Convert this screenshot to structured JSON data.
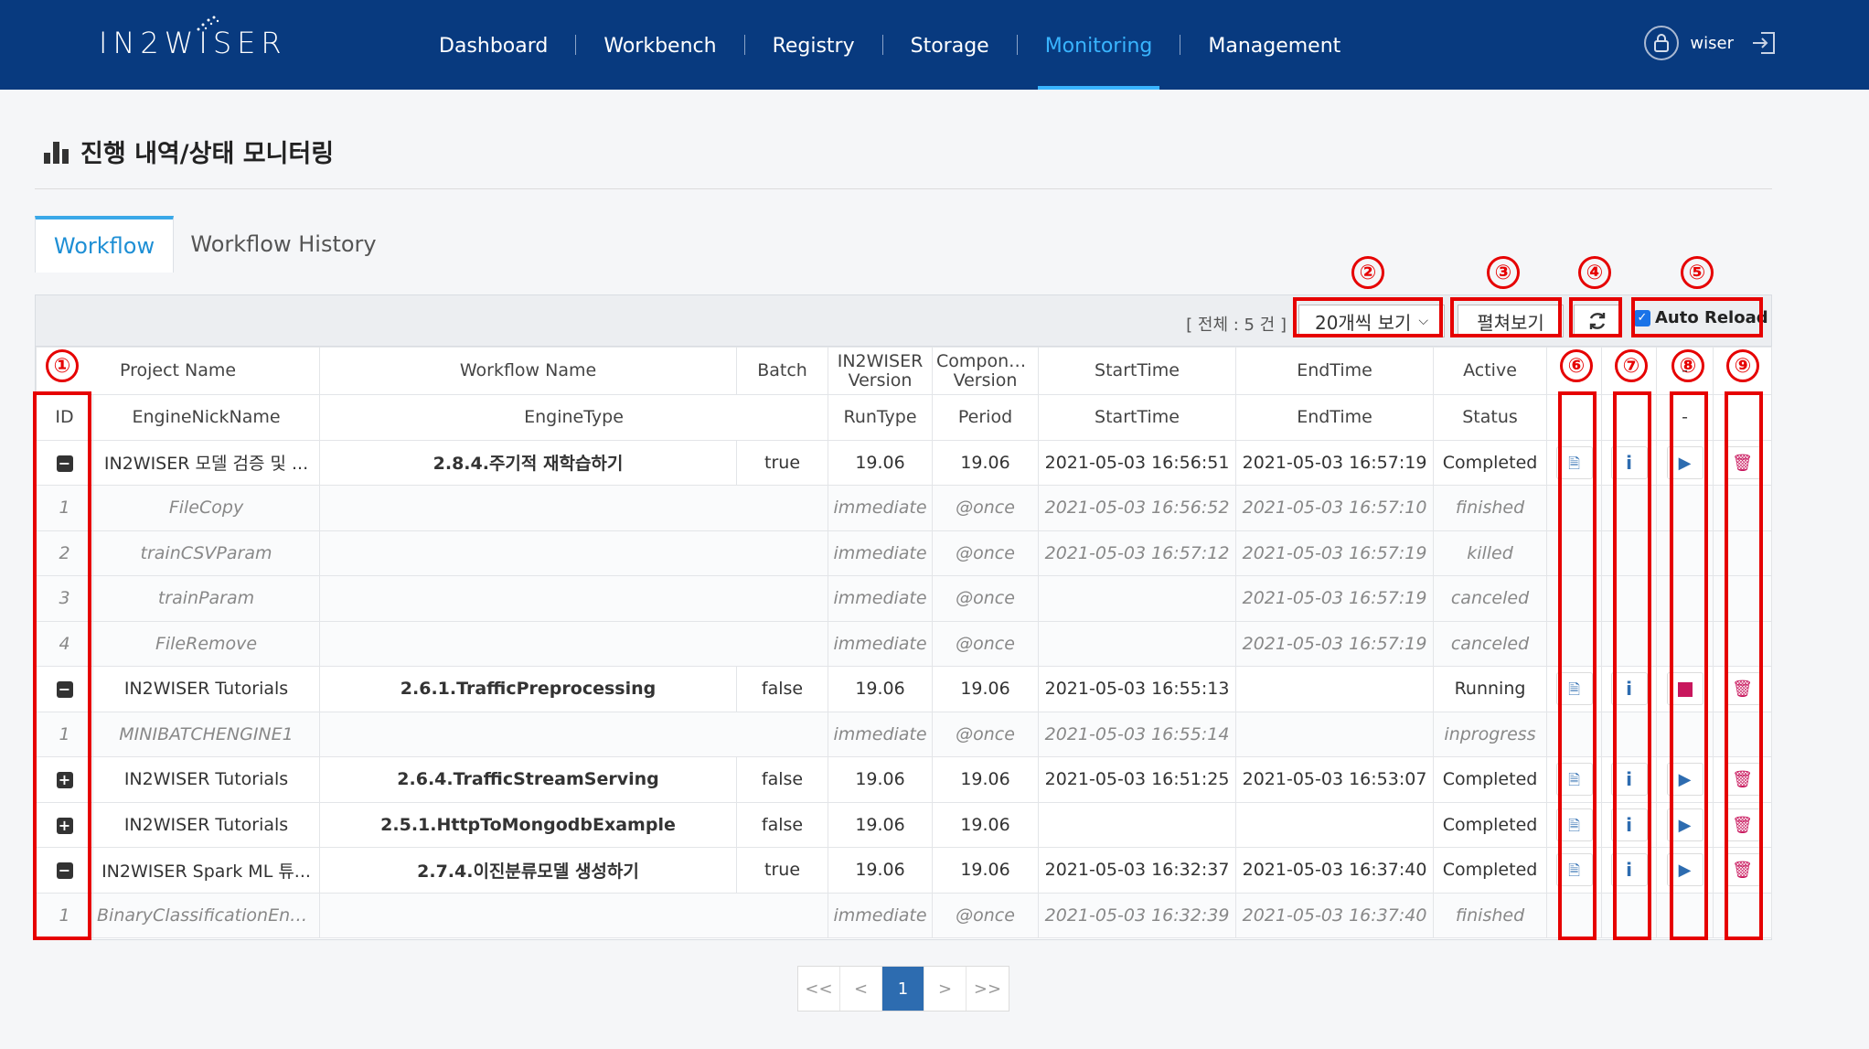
{
  "header": {
    "logo": "IN2WISER",
    "nav": [
      "Dashboard",
      "Workbench",
      "Registry",
      "Storage",
      "Monitoring",
      "Management"
    ],
    "active_nav": "Monitoring",
    "user": "wiser"
  },
  "page": {
    "title": "진행 내역/상태 모니터링",
    "tabs": [
      "Workflow",
      "Workflow History"
    ]
  },
  "toolbar": {
    "count": "[ 전체 : 5 건 ]",
    "page_size": "20개씩 보기",
    "expand": "펼쳐보기",
    "auto_reload": "Auto Reload"
  },
  "columns": {
    "head1": [
      "Project Name",
      "Workflow Name",
      "Batch",
      "IN2WISER Version",
      "Component Version",
      "StartTime",
      "EndTime",
      "Active"
    ],
    "head2": [
      "ID",
      "EngineNickName",
      "EngineType",
      "RunType",
      "Period",
      "StartTime",
      "EndTime",
      "Status"
    ],
    "dash": "-"
  },
  "rows": [
    {
      "type": "main",
      "toggle": "−",
      "project": "IN2WISER 모델 검증 및 ...",
      "workflow": "2.8.4.주기적 재학습하기",
      "batch": "true",
      "iv": "19.06",
      "cv": "19.06",
      "start": "2021-05-03 16:56:51",
      "end": "2021-05-03 16:57:19",
      "status": "Completed",
      "action": "play"
    },
    {
      "type": "sub",
      "id": "1",
      "engine": "FileCopy",
      "run": "immediate",
      "period": "@once",
      "start": "2021-05-03 16:56:52",
      "end": "2021-05-03 16:57:10",
      "status": "finished"
    },
    {
      "type": "sub",
      "id": "2",
      "engine": "trainCSVParam",
      "run": "immediate",
      "period": "@once",
      "start": "2021-05-03 16:57:12",
      "end": "2021-05-03 16:57:19",
      "status": "killed"
    },
    {
      "type": "sub",
      "id": "3",
      "engine": "trainParam",
      "run": "immediate",
      "period": "@once",
      "start": "",
      "end": "2021-05-03 16:57:19",
      "status": "canceled"
    },
    {
      "type": "sub",
      "id": "4",
      "engine": "FileRemove",
      "run": "immediate",
      "period": "@once",
      "start": "",
      "end": "2021-05-03 16:57:19",
      "status": "canceled"
    },
    {
      "type": "main",
      "toggle": "−",
      "project": "IN2WISER Tutorials",
      "workflow": "2.6.1.TrafficPreprocessing",
      "batch": "false",
      "iv": "19.06",
      "cv": "19.06",
      "start": "2021-05-03 16:55:13",
      "end": "",
      "status": "Running",
      "action": "stop"
    },
    {
      "type": "sub",
      "id": "1",
      "engine": "MINIBATCHENGINE1",
      "run": "immediate",
      "period": "@once",
      "start": "2021-05-03 16:55:14",
      "end": "",
      "status": "inprogress"
    },
    {
      "type": "main",
      "toggle": "+",
      "project": "IN2WISER Tutorials",
      "workflow": "2.6.4.TrafficStreamServing",
      "batch": "false",
      "iv": "19.06",
      "cv": "19.06",
      "start": "2021-05-03 16:51:25",
      "end": "2021-05-03 16:53:07",
      "status": "Completed",
      "action": "play"
    },
    {
      "type": "main",
      "toggle": "+",
      "project": "IN2WISER Tutorials",
      "workflow": "2.5.1.HttpToMongodbExample",
      "batch": "false",
      "iv": "19.06",
      "cv": "19.06",
      "start": "",
      "end": "",
      "status": "Completed",
      "action": "play"
    },
    {
      "type": "main",
      "toggle": "−",
      "project": "IN2WISER Spark ML 튜...",
      "workflow": "2.7.4.이진분류모델 생성하기",
      "batch": "true",
      "iv": "19.06",
      "cv": "19.06",
      "start": "2021-05-03 16:32:37",
      "end": "2021-05-03 16:37:40",
      "status": "Completed",
      "action": "play"
    },
    {
      "type": "sub",
      "id": "1",
      "engine": "BinaryClassificationEngine",
      "run": "immediate",
      "period": "@once",
      "start": "2021-05-03 16:32:39",
      "end": "2021-05-03 16:37:40",
      "status": "finished"
    }
  ],
  "annotations": [
    "①",
    "②",
    "③",
    "④",
    "⑤",
    "⑥",
    "⑦",
    "⑧",
    "⑨"
  ],
  "pagination": [
    "<<",
    "<",
    "1",
    ">",
    ">>"
  ],
  "colors": {
    "header_bg": "#083a7f",
    "accent": "#39b4ff",
    "annotation": "#e60000",
    "delete": "#c8175d"
  }
}
